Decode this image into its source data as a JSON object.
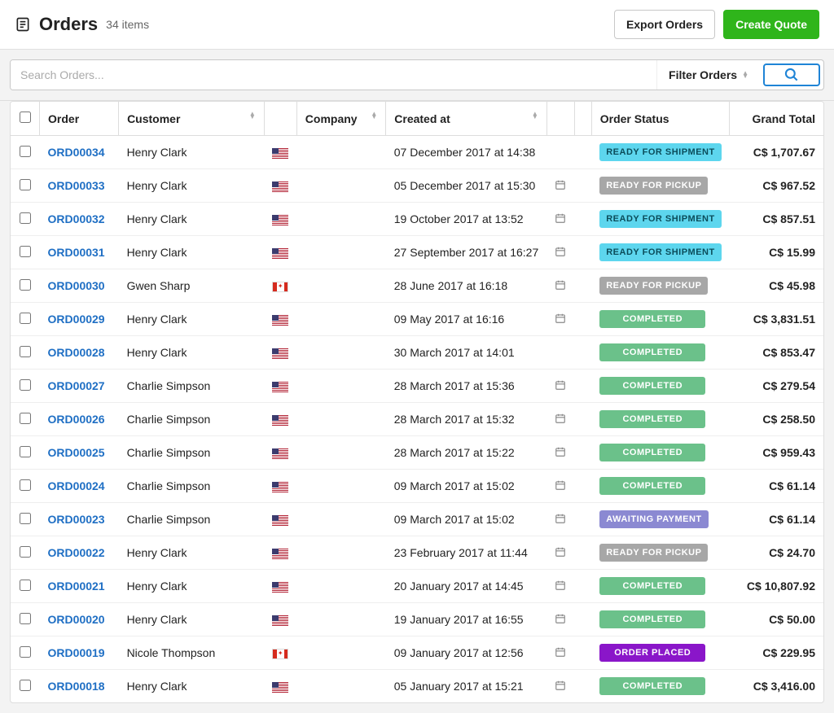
{
  "header": {
    "title": "Orders",
    "count": "34 items",
    "export_label": "Export Orders",
    "create_label": "Create Quote"
  },
  "filter": {
    "search_placeholder": "Search Orders...",
    "filter_label": "Filter Orders"
  },
  "columns": {
    "order": "Order",
    "customer": "Customer",
    "company": "Company",
    "created": "Created at",
    "status": "Order Status",
    "total": "Grand Total"
  },
  "status_labels": {
    "ready_ship": "READY FOR SHIPMENT",
    "ready_pickup": "READY FOR PICKUP",
    "completed": "COMPLETED",
    "awaiting": "AWAITING PAYMENT",
    "placed": "ORDER PLACED"
  },
  "rows": [
    {
      "id": "ORD00034",
      "customer": "Henry Clark",
      "flag": "us",
      "created": "07 December 2017 at 14:38",
      "cal": false,
      "status": "ready_ship",
      "total": "C$ 1,707.67"
    },
    {
      "id": "ORD00033",
      "customer": "Henry Clark",
      "flag": "us",
      "created": "05 December 2017 at 15:30",
      "cal": true,
      "status": "ready_pickup",
      "total": "C$ 967.52"
    },
    {
      "id": "ORD00032",
      "customer": "Henry Clark",
      "flag": "us",
      "created": "19 October 2017 at 13:52",
      "cal": true,
      "status": "ready_ship",
      "total": "C$ 857.51"
    },
    {
      "id": "ORD00031",
      "customer": "Henry Clark",
      "flag": "us",
      "created": "27 September 2017 at 16:27",
      "cal": true,
      "status": "ready_ship",
      "total": "C$ 15.99"
    },
    {
      "id": "ORD00030",
      "customer": "Gwen Sharp",
      "flag": "ca",
      "created": "28 June 2017 at 16:18",
      "cal": true,
      "status": "ready_pickup",
      "total": "C$ 45.98"
    },
    {
      "id": "ORD00029",
      "customer": "Henry Clark",
      "flag": "us",
      "created": "09 May 2017 at 16:16",
      "cal": true,
      "status": "completed",
      "total": "C$ 3,831.51"
    },
    {
      "id": "ORD00028",
      "customer": "Henry Clark",
      "flag": "us",
      "created": "30 March 2017 at 14:01",
      "cal": false,
      "status": "completed",
      "total": "C$ 853.47"
    },
    {
      "id": "ORD00027",
      "customer": "Charlie Simpson",
      "flag": "us",
      "created": "28 March 2017 at 15:36",
      "cal": true,
      "status": "completed",
      "total": "C$ 279.54"
    },
    {
      "id": "ORD00026",
      "customer": "Charlie Simpson",
      "flag": "us",
      "created": "28 March 2017 at 15:32",
      "cal": true,
      "status": "completed",
      "total": "C$ 258.50"
    },
    {
      "id": "ORD00025",
      "customer": "Charlie Simpson",
      "flag": "us",
      "created": "28 March 2017 at 15:22",
      "cal": true,
      "status": "completed",
      "total": "C$ 959.43"
    },
    {
      "id": "ORD00024",
      "customer": "Charlie Simpson",
      "flag": "us",
      "created": "09 March 2017 at 15:02",
      "cal": true,
      "status": "completed",
      "total": "C$ 61.14"
    },
    {
      "id": "ORD00023",
      "customer": "Charlie Simpson",
      "flag": "us",
      "created": "09 March 2017 at 15:02",
      "cal": true,
      "status": "awaiting",
      "total": "C$ 61.14"
    },
    {
      "id": "ORD00022",
      "customer": "Henry Clark",
      "flag": "us",
      "created": "23 February 2017 at 11:44",
      "cal": true,
      "status": "ready_pickup",
      "total": "C$ 24.70"
    },
    {
      "id": "ORD00021",
      "customer": "Henry Clark",
      "flag": "us",
      "created": "20 January 2017 at 14:45",
      "cal": true,
      "status": "completed",
      "total": "C$ 10,807.92"
    },
    {
      "id": "ORD00020",
      "customer": "Henry Clark",
      "flag": "us",
      "created": "19 January 2017 at 16:55",
      "cal": true,
      "status": "completed",
      "total": "C$ 50.00"
    },
    {
      "id": "ORD00019",
      "customer": "Nicole Thompson",
      "flag": "ca",
      "created": "09 January 2017 at 12:56",
      "cal": true,
      "status": "placed",
      "total": "C$ 229.95"
    },
    {
      "id": "ORD00018",
      "customer": "Henry Clark",
      "flag": "us",
      "created": "05 January 2017 at 15:21",
      "cal": true,
      "status": "completed",
      "total": "C$ 3,416.00"
    }
  ]
}
